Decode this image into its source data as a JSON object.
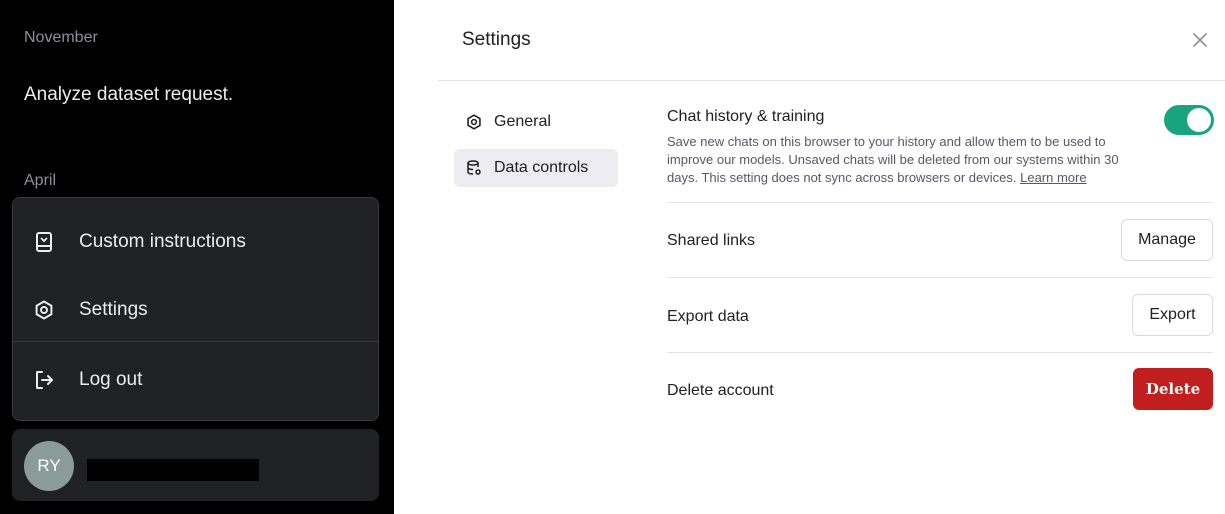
{
  "sidebar": {
    "section_november": "November",
    "chat_item": "Analyze dataset request.",
    "section_april": "April",
    "menu": {
      "custom_instructions": "Custom instructions",
      "settings": "Settings",
      "log_out": "Log out"
    },
    "user": {
      "initials": "RY"
    }
  },
  "settings": {
    "title": "Settings",
    "nav": {
      "general": "General",
      "data_controls": "Data controls"
    },
    "chat_history": {
      "title": "Chat history & training",
      "description": "Save new chats on this browser to your history and allow them to be used to improve our models. Unsaved chats will be deleted from our systems within 30 days. This setting does not sync across browsers or devices.",
      "learn_more": "Learn more",
      "enabled": true
    },
    "shared_links": {
      "title": "Shared links",
      "button": "Manage"
    },
    "export_data": {
      "title": "Export data",
      "button": "Export"
    },
    "delete_account": {
      "title": "Delete account",
      "button": "Delete"
    }
  },
  "colors": {
    "toggle_on": "#19a37f",
    "danger": "#c11f1f",
    "sidebar_bg": "#000000",
    "menu_bg": "#202123"
  }
}
